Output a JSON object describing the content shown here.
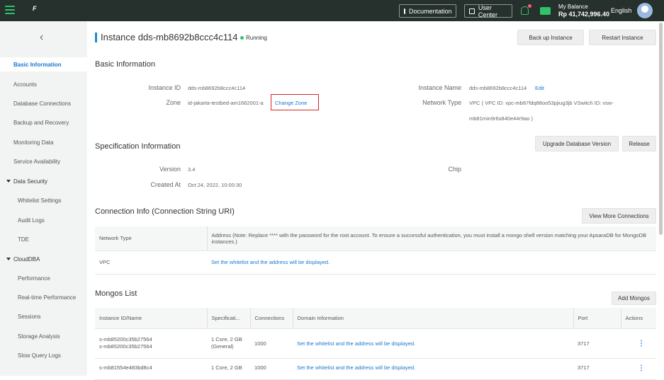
{
  "topbar": {
    "documentation": "Documentation",
    "user_center": "User Center",
    "balance_label": "My Balance",
    "balance_value": "Rp 41,742,996.40",
    "language": "English",
    "logo_text": "F"
  },
  "sidebar": {
    "back": "‹",
    "items": [
      {
        "label": "Basic Information"
      },
      {
        "label": "Accounts"
      },
      {
        "label": "Database Connections"
      },
      {
        "label": "Backup and Recovery"
      },
      {
        "label": "Monitoring Data"
      },
      {
        "label": "Service Availability"
      },
      {
        "label": "Data Security"
      },
      {
        "label": "Whitelist Settings"
      },
      {
        "label": "Audit Logs"
      },
      {
        "label": "TDE"
      },
      {
        "label": "CloudDBA"
      },
      {
        "label": "Performance"
      },
      {
        "label": "Real-time Performance"
      },
      {
        "label": "Sessions"
      },
      {
        "label": "Storage Analysis"
      },
      {
        "label": "Slow Query Logs"
      }
    ]
  },
  "header": {
    "title": "Instance dds-mb8692b8ccc4c114",
    "status": "Running",
    "backup_btn": "Back up Instance",
    "restart_btn": "Restart Instance"
  },
  "basic": {
    "title": "Basic Information",
    "instance_id_label": "Instance ID",
    "instance_id": "dds-mb8692b8ccc4c114",
    "zone_label": "Zone",
    "zone": "id-jakarta-testbed-am1662001-a",
    "change_zone": "Change Zone",
    "instance_name_label": "Instance Name",
    "instance_name": "dds-mb8692b8ccc4c114",
    "edit": "Edit",
    "network_type_label": "Network Type",
    "network_type_line1": "VPC ( VPC ID: vpc-mb87fdq88oo53pjiug3jb VSwitch ID: vsw-",
    "network_type_line2": "mb81min9r6s840e44r9ao )"
  },
  "spec": {
    "title": "Specification Information",
    "upgrade_btn": "Upgrade Database Version",
    "release_btn": "Release",
    "version_label": "Version",
    "version": "3.4",
    "created_label": "Created At",
    "created": "Oct 24, 2022, 10:00:30",
    "chip_label": "Chip"
  },
  "conn": {
    "title": "Connection Info (Connection String URI)",
    "view_btn": "View More Connections",
    "col_network": "Network Type",
    "col_address": "Address (Note: Replace **** with the password for the root account. To ensure a successful authentication, you must install a mongo shell version matching your ApsaraDB for MongoDB instances.)",
    "row_type": "VPC",
    "row_address": "Set the whitelist and the address will be displayed."
  },
  "mongos": {
    "title": "Mongos List",
    "add_btn": "Add Mongos",
    "columns": [
      "Instance ID/Name",
      "Specificati...",
      "Connections",
      "Domain Information",
      "Port",
      "Actions"
    ],
    "rows": [
      {
        "id1": "s-mb85200c35b27564",
        "id2": "s-mb85200c35b27564",
        "spec1": "1 Core, 2 GB",
        "spec2": "(General)",
        "connections": "1000",
        "domain": "Set the whitelist and the address will be displayed.",
        "port": "3717",
        "action": "⋮"
      },
      {
        "id1": "s-mb81554e483bd8c4",
        "id2": "",
        "spec1": "1 Core, 2 GB",
        "spec2": "",
        "connections": "1000",
        "domain": "Set the whitelist and the address will be displayed.",
        "port": "3717",
        "action": "⋮"
      }
    ]
  }
}
